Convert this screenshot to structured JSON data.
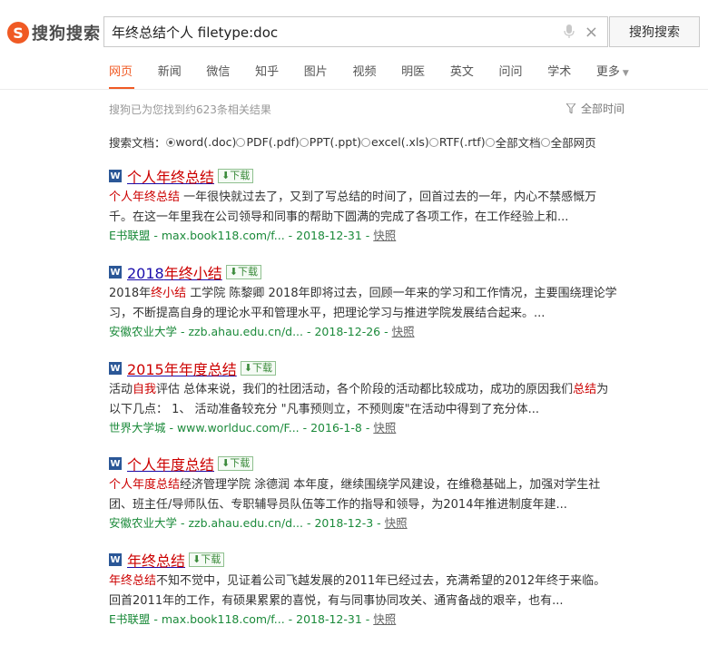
{
  "brand": {
    "logo_text": "搜狗搜索",
    "logo_mark": "S"
  },
  "search": {
    "query": "年终总结个人 filetype:doc",
    "button": "搜狗搜索"
  },
  "tabs": [
    "网页",
    "新闻",
    "微信",
    "知乎",
    "图片",
    "视频",
    "明医",
    "英文",
    "问问",
    "学术",
    "更多"
  ],
  "active_tab": "网页",
  "result_count": "搜狗已为您找到约623条相关结果",
  "time_filter": "全部时间",
  "doc_filter": {
    "label": "搜索文档：",
    "options": [
      "word(.doc)",
      "PDF(.pdf)",
      "PPT(.ppt)",
      "excel(.xls)",
      "RTF(.rtf)",
      "全部文档",
      "全部网页"
    ],
    "selected": "word(.doc)"
  },
  "download_label": "下载",
  "snapshot_label": "快照",
  "results": [
    {
      "title_parts": [
        [
          "个人年终总结",
          true
        ]
      ],
      "snippet_parts": [
        [
          "个人年终总结",
          true
        ],
        [
          " 一年很快就过去了，又到了写总结的时间了，回首过去的一年，内心不禁感慨万千。在这一年里我在公司领导和同事的帮助下圆满的完成了各项工作，在工作经验上和...",
          false
        ]
      ],
      "source": "E书联盟",
      "url": "max.book118.com/f...",
      "date": "2018-12-31"
    },
    {
      "title_parts": [
        [
          "2018",
          false
        ],
        [
          "年终小结",
          true
        ]
      ],
      "snippet_parts": [
        [
          "2018年",
          false
        ],
        [
          "终小结",
          true
        ],
        [
          " 工学院 陈黎卿 2018年即将过去，回顾一年来的学习和工作情况，主要围绕理论学习，不断提高自身的理论水平和管理水平，把理论学习与推进学院发展结合起来。...",
          false
        ]
      ],
      "source": "安徽农业大学",
      "url": "zzb.ahau.edu.cn/d...",
      "date": "2018-12-26"
    },
    {
      "title_parts": [
        [
          "2015年年度总结",
          true
        ]
      ],
      "snippet_parts": [
        [
          "活动",
          false
        ],
        [
          "自我",
          true
        ],
        [
          "评估 总体来说，我们的社团活动，各个阶段的活动都比较成功，成功的原因我们",
          false
        ],
        [
          "总结",
          true
        ],
        [
          "为以下几点： 1、 活动准备较充分 \"凡事预则立，不预则废\"在活动中得到了充分体...",
          false
        ]
      ],
      "source": "世界大学城",
      "url": "www.worlduc.com/F...",
      "date": "2016-1-8"
    },
    {
      "title_parts": [
        [
          "个人年度总结",
          true
        ]
      ],
      "snippet_parts": [
        [
          "个人年度总结",
          true
        ],
        [
          "经济管理学院 涂德润 本年度，继续围绕学风建设，在维稳基础上，加强对学生社团、班主任/导师队伍、专职辅导员队伍等工作的指导和领导，为2014年推进制度年建...",
          false
        ]
      ],
      "source": "安徽农业大学",
      "url": "zzb.ahau.edu.cn/d...",
      "date": "2018-12-3"
    },
    {
      "title_parts": [
        [
          "年终总结",
          true
        ]
      ],
      "snippet_parts": [
        [
          "年终总结",
          true
        ],
        [
          "不知不觉中，见证着公司飞越发展的2011年已经过去，充满希望的2012年终于来临。回首2011年的工作，有硕果累累的喜悦，有与同事协同攻关、通宵备战的艰辛，也有...",
          false
        ]
      ],
      "source": "E书联盟",
      "url": "max.book118.com/f...",
      "date": "2018-12-31"
    }
  ],
  "colors": {
    "accent": "#f05a24",
    "link": "#1a0dab",
    "highlight": "#cc0000",
    "url_green": "#1b8a3a"
  }
}
